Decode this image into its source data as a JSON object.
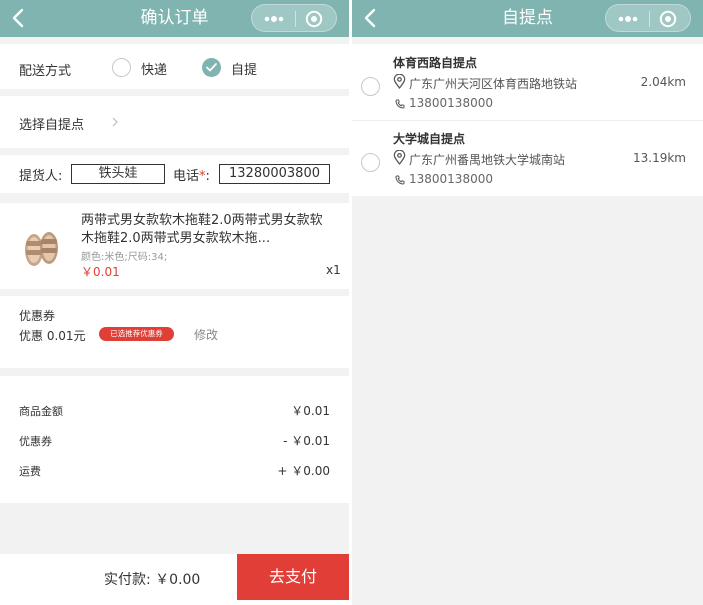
{
  "left": {
    "nav": {
      "title": "确认订单"
    },
    "delivery": {
      "label": "配送方式",
      "option_express": "快递",
      "option_pickup": "自提",
      "selected": "自提"
    },
    "pickup_point": {
      "label": "选择自提点",
      "chevron": "›"
    },
    "pickup_person": {
      "label": "提货人:",
      "name": "铁头娃",
      "phone_label": "电话",
      "required_mark": "*",
      "colon": ":",
      "phone": "13280003800"
    },
    "product": {
      "title": "两带式男女款软木拖鞋2.0两带式男女款软木拖鞋2.0两带式男女款软木拖...",
      "spec": "颜色:米色;尺码:34;",
      "price": "￥0.01",
      "qty": "x1"
    },
    "coupon": {
      "title": "优惠券",
      "amount": "优惠 0.01元",
      "tag": "已选推荐优惠券",
      "modify": "修改"
    },
    "summary": [
      {
        "label": "商品金额",
        "value": "￥0.01"
      },
      {
        "label": "优惠券",
        "value": "- ￥0.01"
      },
      {
        "label": "运费",
        "value": "+ ￥0.00"
      }
    ],
    "bottom": {
      "paid_label": "实付款: ￥0.00",
      "pay_button": "去支付"
    }
  },
  "right": {
    "nav": {
      "title": "自提点"
    },
    "points": [
      {
        "name": "体育西路自提点",
        "address": "广东广州天河区体育西路地铁站",
        "distance": "2.04km",
        "phone": "13800138000"
      },
      {
        "name": "大学城自提点",
        "address": "广东广州番禺地铁大学城南站",
        "distance": "13.19km",
        "phone": "13800138000"
      }
    ]
  },
  "colors": {
    "nav": "#7fb4b1",
    "accent": "#e03e36",
    "background": "#f2f2f2"
  },
  "icons": [
    "back-arrow-icon",
    "more-dots-icon",
    "close-circle-icon",
    "check-icon",
    "chevron-right-icon",
    "location-pin-icon",
    "phone-icon",
    "slipper-icon"
  ]
}
